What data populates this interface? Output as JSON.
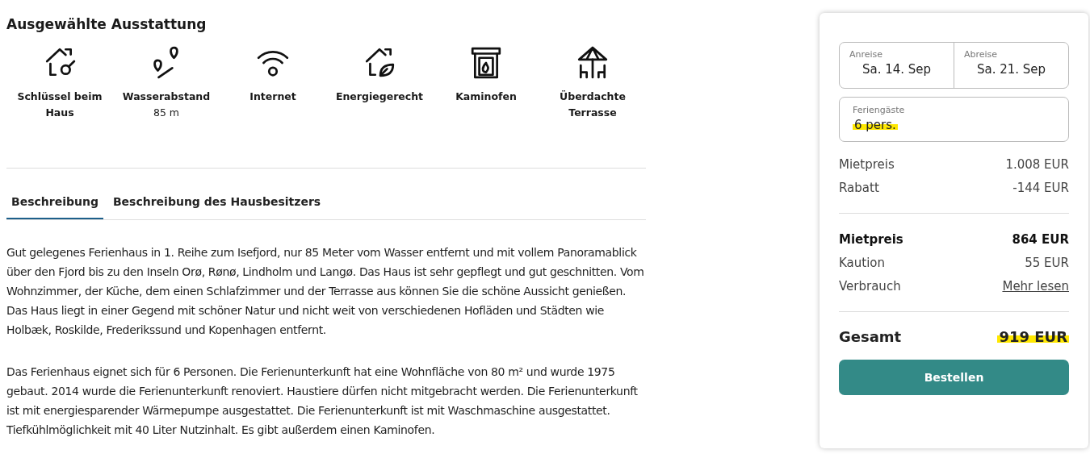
{
  "amenities": {
    "title": "Ausgewählte Ausstattung",
    "items": [
      {
        "label": "Schlüssel beim Haus"
      },
      {
        "label": "Wasserabstand",
        "value": "85 m"
      },
      {
        "label": "Internet"
      },
      {
        "label": "Energiegerecht"
      },
      {
        "label": "Kaminofen"
      },
      {
        "label": "Überdachte Terrasse"
      }
    ]
  },
  "tabs": [
    {
      "label": "Beschreibung",
      "selected": true
    },
    {
      "label": "Beschreibung des Hausbesitzers",
      "selected": false
    }
  ],
  "description": [
    "Gut gelegenes Ferienhaus in 1. Reihe zum Isefjord, nur 85 Meter vom Wasser entfernt und mit vollem Panoramablick über den Fjord bis zu den Inseln Orø, Rønø, Lindholm und Langø. Das Haus ist sehr gepflegt und gut geschnitten. Vom Wohnzimmer, der Küche, dem einen Schlafzimmer und der Terrasse aus können Sie die schöne Aussicht genießen. Das Haus liegt in einer Gegend mit schöner Natur und nicht weit von verschiedenen Hofläden und Städten wie Holbæk, Roskilde, Frederikssund und Kopenhagen entfernt.",
    "Das Ferienhaus eignet sich für 6 Personen. Die Ferienunterkunft hat eine Wohnfläche von 80 m² und wurde 1975 gebaut. 2014 wurde die Ferienunterkunft renoviert. Haustiere dürfen nicht mitgebracht werden. Die Ferienunterkunft ist mit energiesparender Wärmepumpe ausgestattet. Die Ferienunterkunft ist mit Waschmaschine ausgestattet. Tiefkühlmöglichkeit mit 40 Liter Nutzinhalt. Es gibt außerdem einen Kaminofen."
  ],
  "booking": {
    "arrival": {
      "label": "Anreise",
      "value": "Sa. 14. Sep"
    },
    "departure": {
      "label": "Abreise",
      "value": "Sa. 21. Sep"
    },
    "guests": {
      "label": "Feriengäste",
      "value": "6 pers.",
      "highlighted": true
    },
    "price_groups": [
      [
        {
          "label": "Mietpreis",
          "value": "1.008 EUR",
          "kind": "plain"
        },
        {
          "label": "Rabatt",
          "value": "-144 EUR",
          "kind": "plain"
        }
      ],
      [
        {
          "label": "Mietpreis",
          "value": "864 EUR",
          "kind": "bold"
        },
        {
          "label": "Kaution",
          "value": "55 EUR",
          "kind": "plain"
        },
        {
          "label": "Verbrauch",
          "value": "Mehr lesen",
          "kind": "link"
        }
      ]
    ],
    "total": {
      "label": "Gesamt",
      "value": "919 EUR",
      "highlighted": true
    },
    "button": "Bestellen"
  }
}
